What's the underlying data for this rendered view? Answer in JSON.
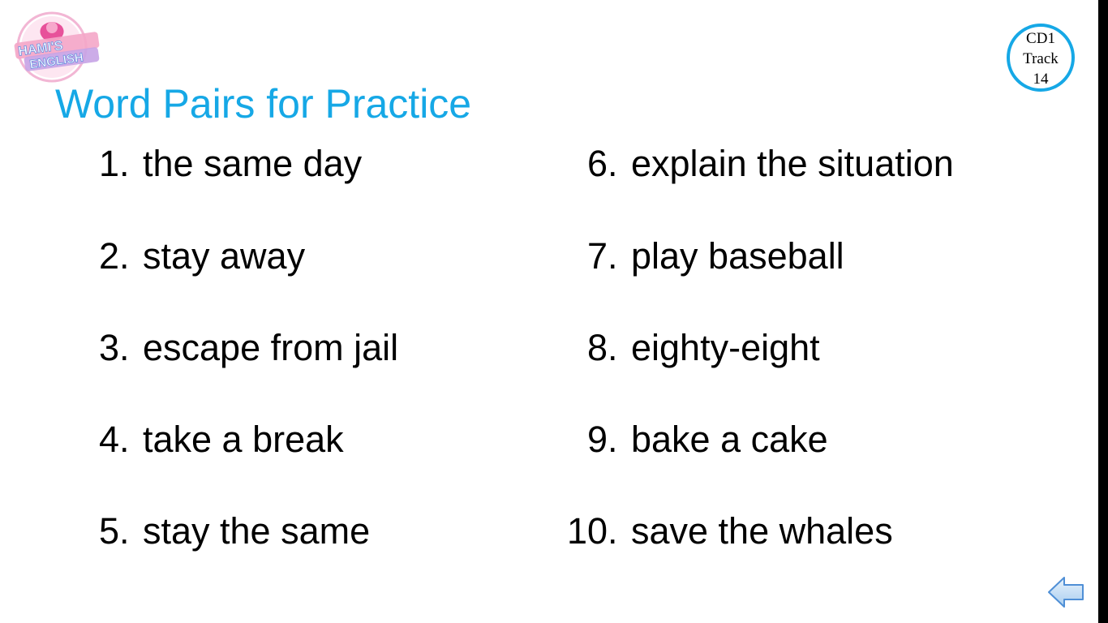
{
  "slide": {
    "title": "Word Pairs for Practice",
    "logo_text": [
      "HAMI'S",
      "ENGLISH"
    ],
    "badge": {
      "line1": "CD1",
      "line2": "Track",
      "line3": "14",
      "color": "#16a8e6"
    },
    "items_left": [
      {
        "number": "1.",
        "text": "the same day"
      },
      {
        "number": "2.",
        "text": "stay away"
      },
      {
        "number": "3.",
        "text": "escape from jail"
      },
      {
        "number": "4.",
        "text": "take a break"
      },
      {
        "number": "5.",
        "text": "stay the same"
      }
    ],
    "items_right": [
      {
        "number": "6.",
        "text": "explain the situation"
      },
      {
        "number": "7.",
        "text": "play baseball"
      },
      {
        "number": "8.",
        "text": "eighty-eight"
      },
      {
        "number": "9.",
        "text": "bake a cake"
      },
      {
        "number": "10.",
        "text": "save the whales"
      }
    ],
    "back_button_icon": "left-arrow-icon",
    "title_color": "#16a8e6"
  }
}
